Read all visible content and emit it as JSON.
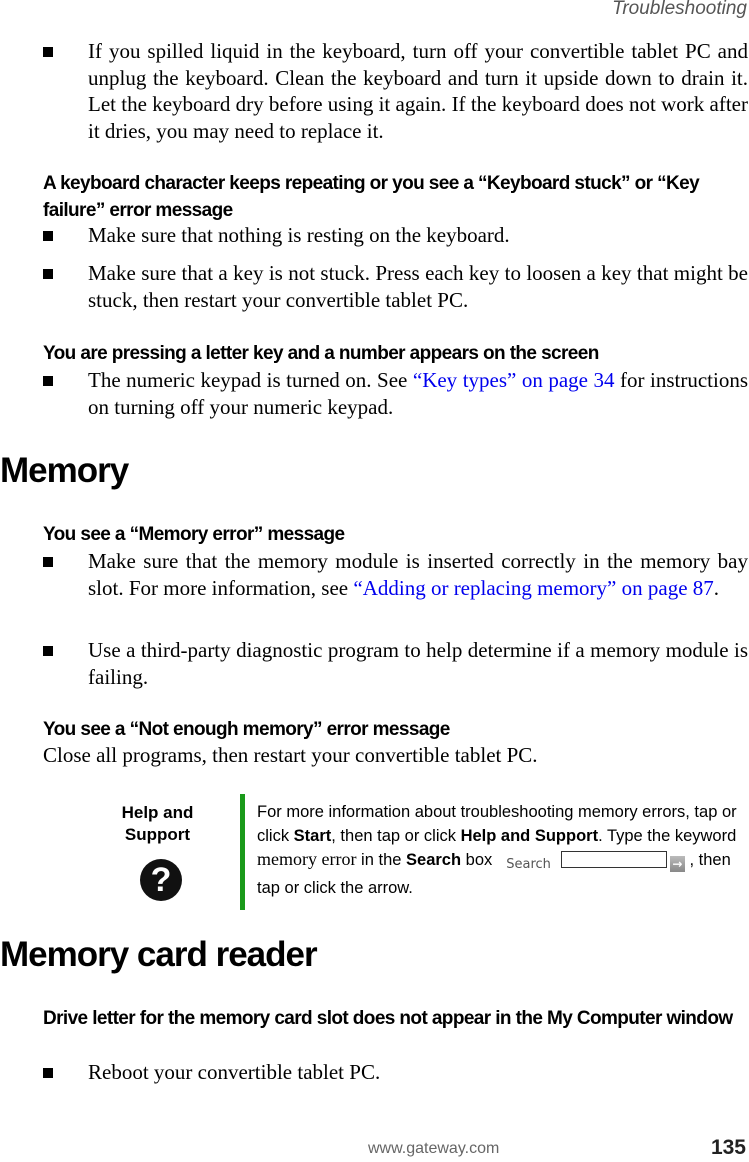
{
  "header": {
    "running_head": "Troubleshooting"
  },
  "keyboard": {
    "spill_bullet": "If you spilled liquid in the keyboard, turn off your convertible tablet PC and unplug the keyboard. Clean the keyboard and turn it upside down to drain it. Let the keyboard dry before using it again. If the keyboard does not work after it dries, you may need to replace it.",
    "repeat_heading": "A keyboard character keeps repeating or you see a “Keyboard stuck” or “Key failure” error message",
    "repeat_bullets": [
      "Make sure that nothing is resting on the keyboard.",
      "Make sure that a key is not stuck. Press each key to loosen a key that might be stuck, then restart your convertible tablet PC."
    ],
    "number_heading": "You are pressing a letter key and a number appears on the screen",
    "number_bullet": {
      "before": "The numeric keypad is turned on. See ",
      "link": "“Key types” on page 34",
      "after": " for instructions on turning off your numeric keypad."
    }
  },
  "memory": {
    "title": "Memory",
    "error_heading": "You see a “Memory error” message",
    "error_bullet1": {
      "before": "Make sure that the memory module is inserted correctly in the memory bay slot. For more information, see ",
      "link": "“Adding or replacing memory” on page 87",
      "after": "."
    },
    "error_bullet2": "Use a third-party diagnostic program to help determine if a memory module is failing.",
    "notenough_heading": "You see a “Not enough memory” error message",
    "notenough_text": "Close all programs, then restart your convertible tablet PC."
  },
  "help": {
    "label_line1": "Help and",
    "label_line2": "Support",
    "icon_glyph": "?",
    "t1": "For more information about troubleshooting memory errors, tap or click ",
    "b1": "Start",
    "t2": ", then tap or click ",
    "b2": "Help and Support",
    "t3": ". Type the keyword ",
    "keyword": "memory error",
    "t4": " in the ",
    "b3": "Search",
    "t5": " box",
    "search_label": "Search",
    "search_value": "",
    "go_glyph": "→",
    "t6": " , then tap or click the arrow."
  },
  "card_reader": {
    "title": "Memory card reader",
    "heading": "Drive letter for the memory card slot does not appear in the My Computer window",
    "bullet": "Reboot your convertible tablet PC."
  },
  "footer": {
    "url": "www.gateway.com",
    "page_number": "135"
  }
}
